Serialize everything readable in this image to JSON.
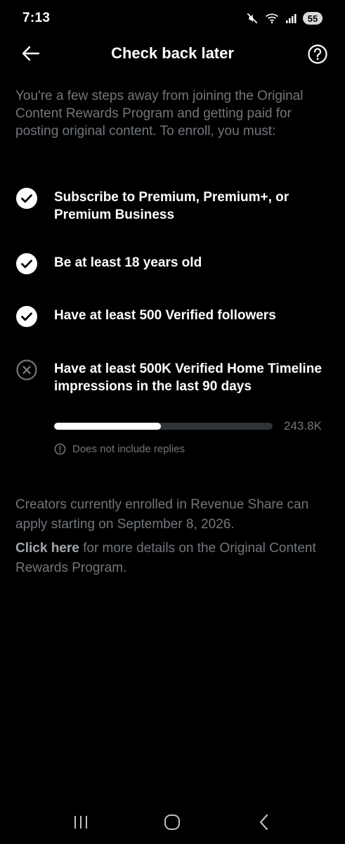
{
  "status_bar": {
    "time": "7:13",
    "battery": "55",
    "icons": [
      "mute-icon",
      "wifi-icon",
      "signal-icon",
      "battery-icon"
    ]
  },
  "header": {
    "title": "Check back later",
    "back_icon": "arrow-left-icon",
    "help_icon": "question-circle-icon"
  },
  "intro": "You're a few steps away from joining the Original Content Rewards Program and getting paid for posting original content. To enroll, you must:",
  "requirements": [
    {
      "text": "Subscribe to Premium, Premium+, or Premium Business",
      "met": true
    },
    {
      "text": "Be at least 18 years old",
      "met": true
    },
    {
      "text": "Have at least 500 Verified followers",
      "met": true
    },
    {
      "text": "Have at least 500K Verified Home Timeline impressions in the last 90 days",
      "met": false
    }
  ],
  "impressions_progress": {
    "fraction": 0.4876,
    "value_label": "243.8K",
    "note": "Does not include replies"
  },
  "footer": {
    "enrolled_text": "Creators currently enrolled in Revenue Share can apply starting on September 8, 2026.",
    "link_text": "Click here",
    "link_suffix": " for more details on the Original Content Rewards Program."
  },
  "colors": {
    "background": "#000000",
    "primary_text": "#ffffff",
    "secondary_text": "#71767b",
    "progress_track": "#2f3336",
    "progress_fill": "#ffffff"
  }
}
